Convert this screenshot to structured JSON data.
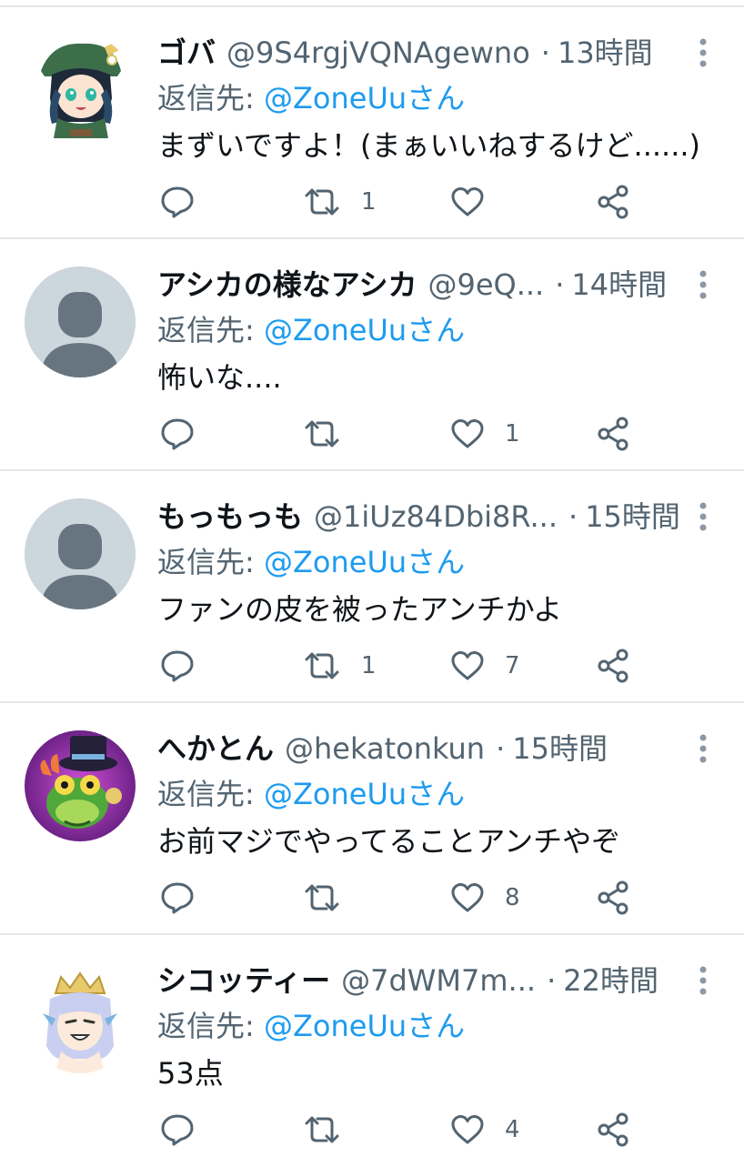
{
  "reply_prefix": "返信先:",
  "tweets": [
    {
      "display_name": "ゴバ",
      "handle": "@9S4rgjVQNAgewno",
      "dot": "·",
      "time": "13時間",
      "reply_to": "@ZoneUu",
      "reply_suffix": "さん",
      "text": "まずいですよ！(まぁいいねするけど......)",
      "retweets": "1",
      "likes": "",
      "avatar": "anime-character"
    },
    {
      "display_name": "アシカの様なアシカ",
      "handle": "@9eQ...",
      "dot": "·",
      "time": "14時間",
      "reply_to": "@ZoneUu",
      "reply_suffix": "さん",
      "text": "怖いな....",
      "retweets": "",
      "likes": "1",
      "avatar": "default-user"
    },
    {
      "display_name": "もっもっも",
      "handle": "@1iUz84Dbi8R...",
      "dot": "·",
      "time": "15時間",
      "reply_to": "@ZoneUu",
      "reply_suffix": "さん",
      "text": "ファンの皮を被ったアンチかよ",
      "retweets": "1",
      "likes": "7",
      "avatar": "default-user"
    },
    {
      "display_name": "へかとん",
      "handle": "@hekatonkun",
      "dot": "·",
      "time": "15時間",
      "reply_to": "@ZoneUu",
      "reply_suffix": "さん",
      "text": "お前マジでやってることアンチやぞ",
      "retweets": "",
      "likes": "8",
      "avatar": "frog-character"
    },
    {
      "display_name": "シコッティー",
      "handle": "@7dWM7m...",
      "dot": "·",
      "time": "22時間",
      "reply_to": "@ZoneUu",
      "reply_suffix": "さん",
      "text": "53点",
      "retweets": "",
      "likes": "4",
      "avatar": "crowned-character"
    }
  ],
  "icons": {
    "reply": "reply-icon",
    "retweet": "retweet-icon",
    "like": "heart-icon",
    "share": "share-icon",
    "more": "more-vertical-icon"
  },
  "colors": {
    "link": "#1d9bf0",
    "secondary_text": "#536471",
    "primary_text": "#0f1419",
    "divider": "#e3e7ea",
    "default_avatar_bg": "#ccd6dd",
    "default_avatar_fg": "#66757f"
  }
}
